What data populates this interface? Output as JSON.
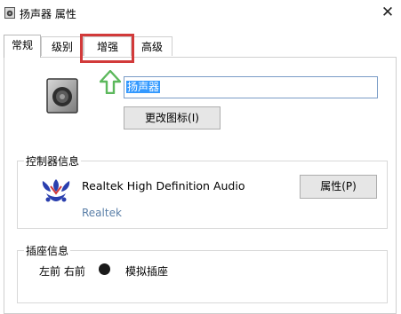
{
  "window": {
    "title": "扬声器 属性",
    "close_glyph": "✕"
  },
  "tabs": [
    {
      "label": "常规",
      "active": true
    },
    {
      "label": "级别",
      "active": false
    },
    {
      "label": "增强",
      "active": false,
      "highlighted": true
    },
    {
      "label": "高级",
      "active": false
    }
  ],
  "general": {
    "device_name": "扬声器",
    "change_icon_button": "更改图标(I)"
  },
  "controller": {
    "group_label": "控制器信息",
    "name": "Realtek High Definition Audio",
    "vendor": "Realtek",
    "properties_button": "属性(P)"
  },
  "jack": {
    "group_label": "插座信息",
    "location": "左前 右前",
    "type": "模拟插座"
  },
  "annotations": {
    "highlight_color": "#d23a3a",
    "arrow_color": "#5cb85c"
  },
  "icons": {
    "title": "speaker-icon",
    "device": "speaker-icon",
    "arrow": "arrow-up-icon",
    "controller_logo": "realtek-logo-icon",
    "jack": "jack-dot-icon"
  }
}
